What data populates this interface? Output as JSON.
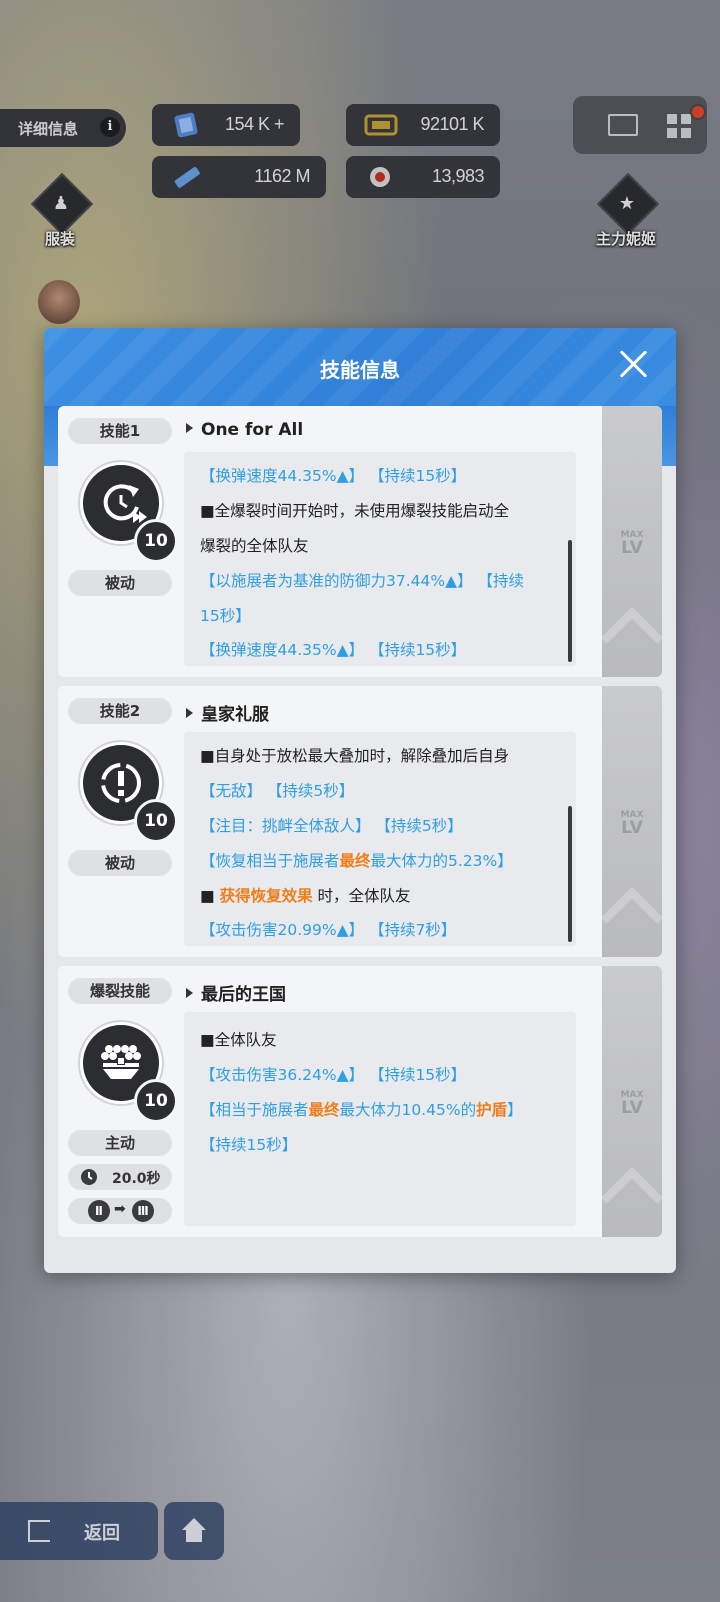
{
  "hud": {
    "details_label": "详细信息",
    "info_icon": "i",
    "resources": [
      {
        "icon": "gem-icon",
        "value": "154 K +"
      },
      {
        "icon": "credit-icon",
        "value": "92101 K"
      },
      {
        "icon": "battery-icon",
        "value": "1162 M"
      },
      {
        "icon": "core-icon",
        "value": "13,983"
      }
    ],
    "costume_label": "服装",
    "main_nikke_label": "主力妮姬"
  },
  "bottom": {
    "back_label": "返回"
  },
  "modal": {
    "title": "技能信息",
    "skills": [
      {
        "tag": "技能1",
        "name": "One for All",
        "type": "被动",
        "level": "10",
        "max_label": "MAX",
        "lv_label": "LV",
        "lines": [
          [
            {
              "t": "【换弹速度44.35%▲】",
              "c": "blue"
            },
            {
              "t": " 【持续15秒】",
              "c": "blue"
            }
          ],
          [
            {
              "t": "■全爆裂时间开始时，未使用爆裂技能启动全",
              "c": ""
            }
          ],
          [
            {
              "t": "爆裂的全体队友",
              "c": ""
            }
          ],
          [
            {
              "t": "【以施展者为基准的防御力37.44%▲】 【持续",
              "c": "blue"
            }
          ],
          [
            {
              "t": "15秒】",
              "c": "blue"
            }
          ],
          [
            {
              "t": "【换弹速度44.35%▲】 【持续15秒】",
              "c": "blue"
            }
          ]
        ]
      },
      {
        "tag": "技能2",
        "name": "皇家礼服",
        "type": "被动",
        "level": "10",
        "max_label": "MAX",
        "lv_label": "LV",
        "lines": [
          [
            {
              "t": "■自身处于放松最大叠加时，解除叠加后自身",
              "c": ""
            }
          ],
          [
            {
              "t": "【无敌】 【持续5秒】",
              "c": "blue"
            }
          ],
          [
            {
              "t": "【注目：挑衅全体敌人】 【持续5秒】",
              "c": "blue"
            }
          ],
          [
            {
              "t": "【恢复相当于施展者",
              "c": "blue"
            },
            {
              "t": "最终",
              "c": "orange"
            },
            {
              "t": "最大体力的5.23%】",
              "c": "blue"
            }
          ],
          [
            {
              "t": "■ ",
              "c": ""
            },
            {
              "t": "获得恢复效果",
              "c": "orange"
            },
            {
              "t": " 时，全体队友",
              "c": ""
            }
          ],
          [
            {
              "t": "【攻击伤害20.99%▲】 【持续7秒】",
              "c": "blue"
            }
          ]
        ]
      },
      {
        "tag": "爆裂技能",
        "name": "最后的王国",
        "type": "主动",
        "level": "10",
        "cooldown": "20.0秒",
        "burst_from": "Ⅱ",
        "burst_to": "Ⅲ",
        "max_label": "MAX",
        "lv_label": "LV",
        "lines": [
          [
            {
              "t": "■全体队友",
              "c": ""
            }
          ],
          [
            {
              "t": "【攻击伤害36.24%▲】 【持续15秒】",
              "c": "blue"
            }
          ],
          [
            {
              "t": "【相当于施展者",
              "c": "blue"
            },
            {
              "t": "最终",
              "c": "orange"
            },
            {
              "t": "最大体力10.45%的",
              "c": "blue"
            },
            {
              "t": "护盾",
              "c": "orange"
            },
            {
              "t": "】",
              "c": "blue"
            }
          ],
          [
            {
              "t": "【持续15秒】",
              "c": "blue"
            }
          ]
        ]
      }
    ]
  }
}
